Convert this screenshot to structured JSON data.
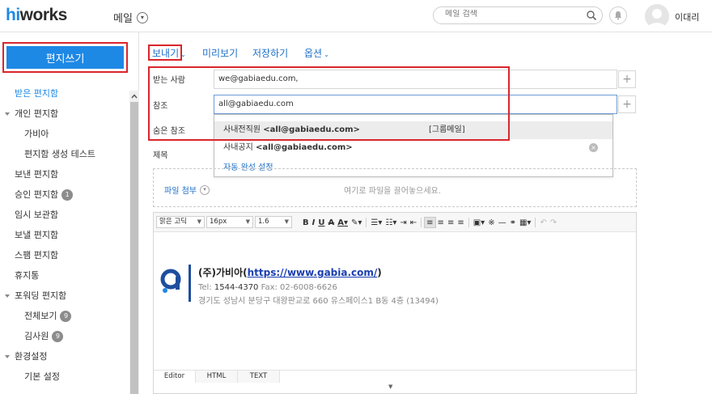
{
  "header": {
    "logo_hi": "hi",
    "logo_rest": "works",
    "app_title": "메일",
    "search_placeholder": "메일 검색",
    "username": "이대리"
  },
  "sidebar": {
    "compose_label": "편지쓰기",
    "items": [
      {
        "label": "받은 편지함",
        "level": "l0",
        "active": true
      },
      {
        "label": "개인 편지함",
        "level": "grp"
      },
      {
        "label": "가비아",
        "level": "l1"
      },
      {
        "label": "편지함 생성 테스트",
        "level": "l1"
      },
      {
        "label": "보낸 편지함",
        "level": "l0"
      },
      {
        "label": "승인 편지함",
        "level": "l0",
        "badge": "1"
      },
      {
        "label": "임시 보관함",
        "level": "l0"
      },
      {
        "label": "보낼 편지함",
        "level": "l0"
      },
      {
        "label": "스팸 편지함",
        "level": "l0"
      },
      {
        "label": "휴지통",
        "level": "l0"
      },
      {
        "label": "포워딩 편지함",
        "level": "grp"
      },
      {
        "label": "전체보기",
        "level": "l1",
        "badge": "9"
      },
      {
        "label": "김사원",
        "level": "l1",
        "badge": "9"
      },
      {
        "label": "환경설정",
        "level": "grp"
      },
      {
        "label": "기본 설정",
        "level": "l1"
      }
    ]
  },
  "toolbar": {
    "send": "보내기",
    "preview": "미리보기",
    "save": "저장하기",
    "options": "옵션"
  },
  "form": {
    "to_label": "받는 사람",
    "to_value": "we@gabiaedu.com,",
    "cc_label": "참조",
    "cc_value": "all@gabiaedu.com",
    "bcc_label": "숨은 참조",
    "subject_label": "제목",
    "autocomplete": {
      "row1_name": "사내전직원",
      "row1_email": "<all@gabiaedu.com>",
      "row1_tag": "[그룹메일]",
      "row2_name": "사내공지",
      "row2_email": "<all@gabiaedu.com>",
      "link": "자동 완성 설정"
    },
    "attach_label": "파일 첨부",
    "attach_hint": "여기로 파일을 끌어놓으세요."
  },
  "editor": {
    "font": "맑은 고딕",
    "size": "16px",
    "line_height": "1.6",
    "tabs": [
      "Editor",
      "HTML",
      "TEXT"
    ],
    "signature": {
      "company": "(주)가비아(",
      "url": "https://www.gabia.com/",
      "company_end": ")",
      "tel_label": "Tel:",
      "tel": "1544-4370",
      "fax": "Fax: 02-6008-6626",
      "address": "경기도 성남시 분당구 대왕판교로 660 유스페이스1 B동 4층 (13494)"
    }
  },
  "colors": {
    "accent": "#1e88e5",
    "highlight_border": "#d9262c"
  }
}
